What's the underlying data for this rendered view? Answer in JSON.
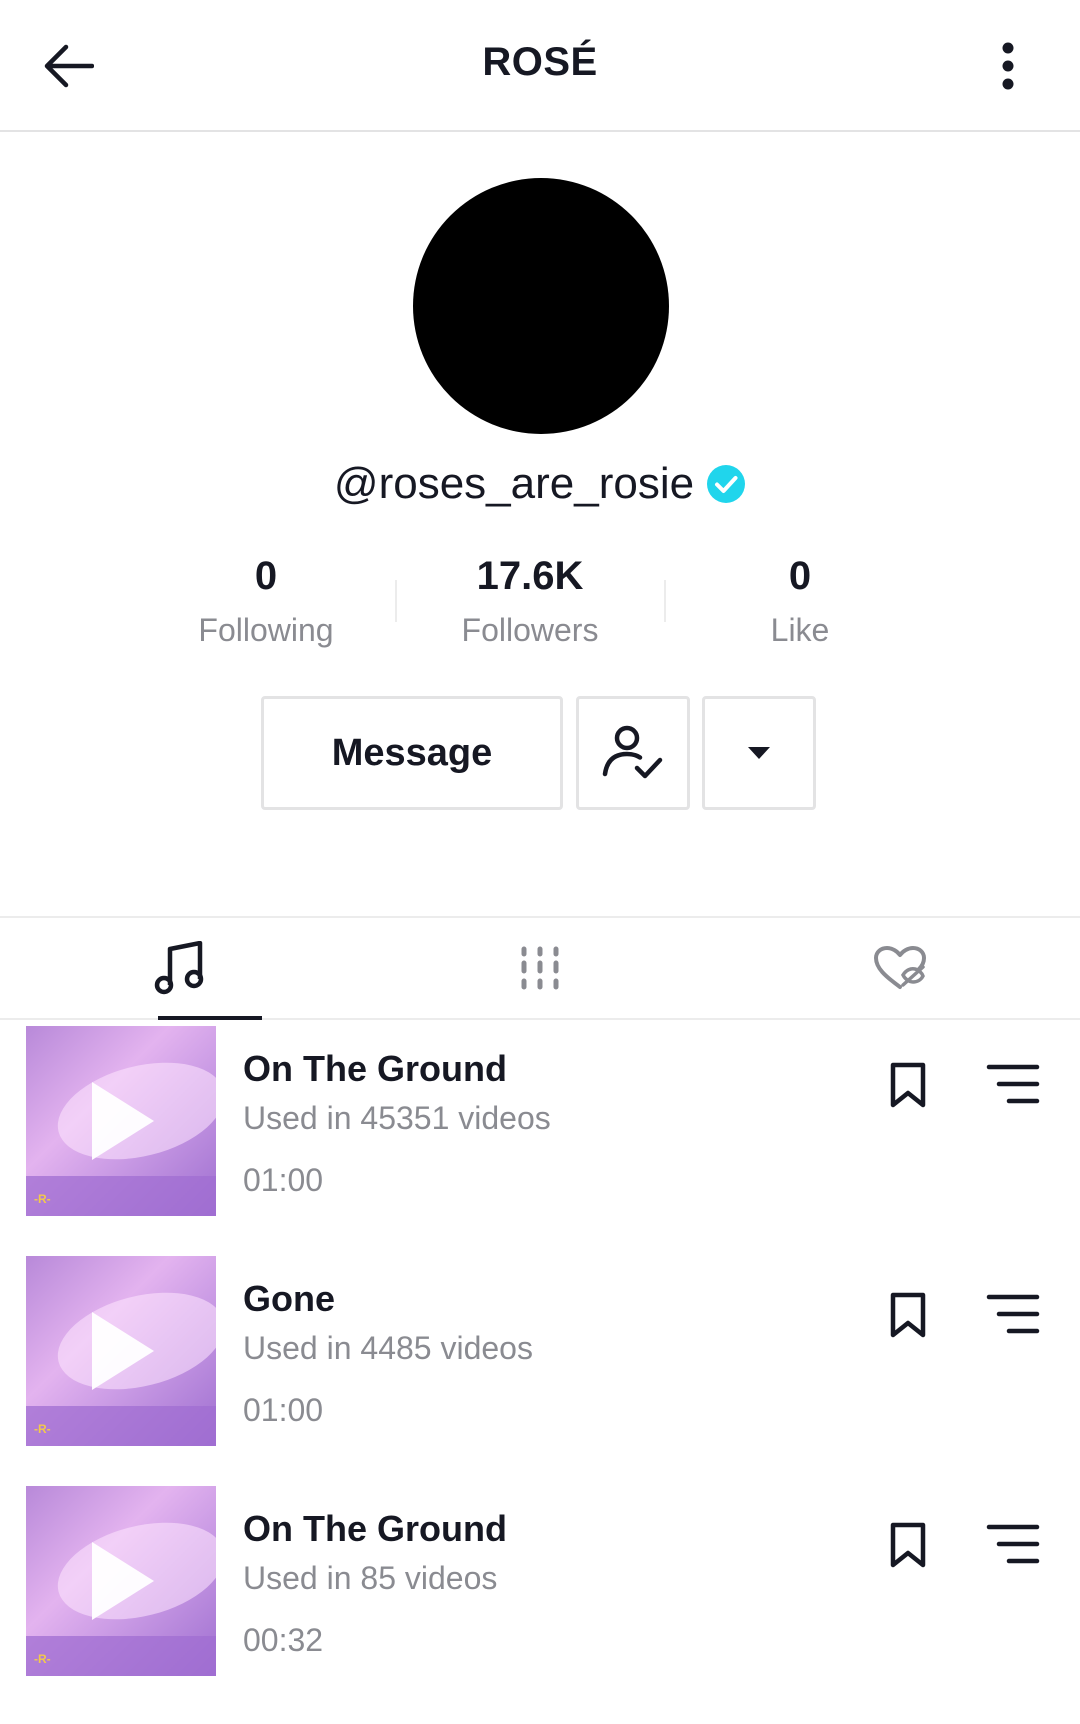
{
  "header": {
    "title": "ROSÉ"
  },
  "profile": {
    "username": "@roses_are_rosie",
    "verified": true,
    "stats": [
      {
        "value": "0",
        "label": "Following"
      },
      {
        "value": "17.6K",
        "label": "Followers"
      },
      {
        "value": "0",
        "label": "Like"
      }
    ]
  },
  "actions": {
    "message_label": "Message"
  },
  "tabs": [
    {
      "icon": "music-note-icon",
      "active": true
    },
    {
      "icon": "grid-icon",
      "active": false
    },
    {
      "icon": "liked-hidden-icon",
      "active": false
    }
  ],
  "sounds": [
    {
      "title": "On The Ground",
      "uses": "Used in 45351 videos",
      "duration": "01:00"
    },
    {
      "title": "Gone",
      "uses": "Used in 4485 videos",
      "duration": "01:00"
    },
    {
      "title": "On The Ground",
      "uses": "Used in 85 videos",
      "duration": "00:32"
    }
  ],
  "colors": {
    "text": "#161823",
    "secondary_text": "#8a8b91",
    "verified": "#20d5ec",
    "border": "#e3e3e4"
  }
}
